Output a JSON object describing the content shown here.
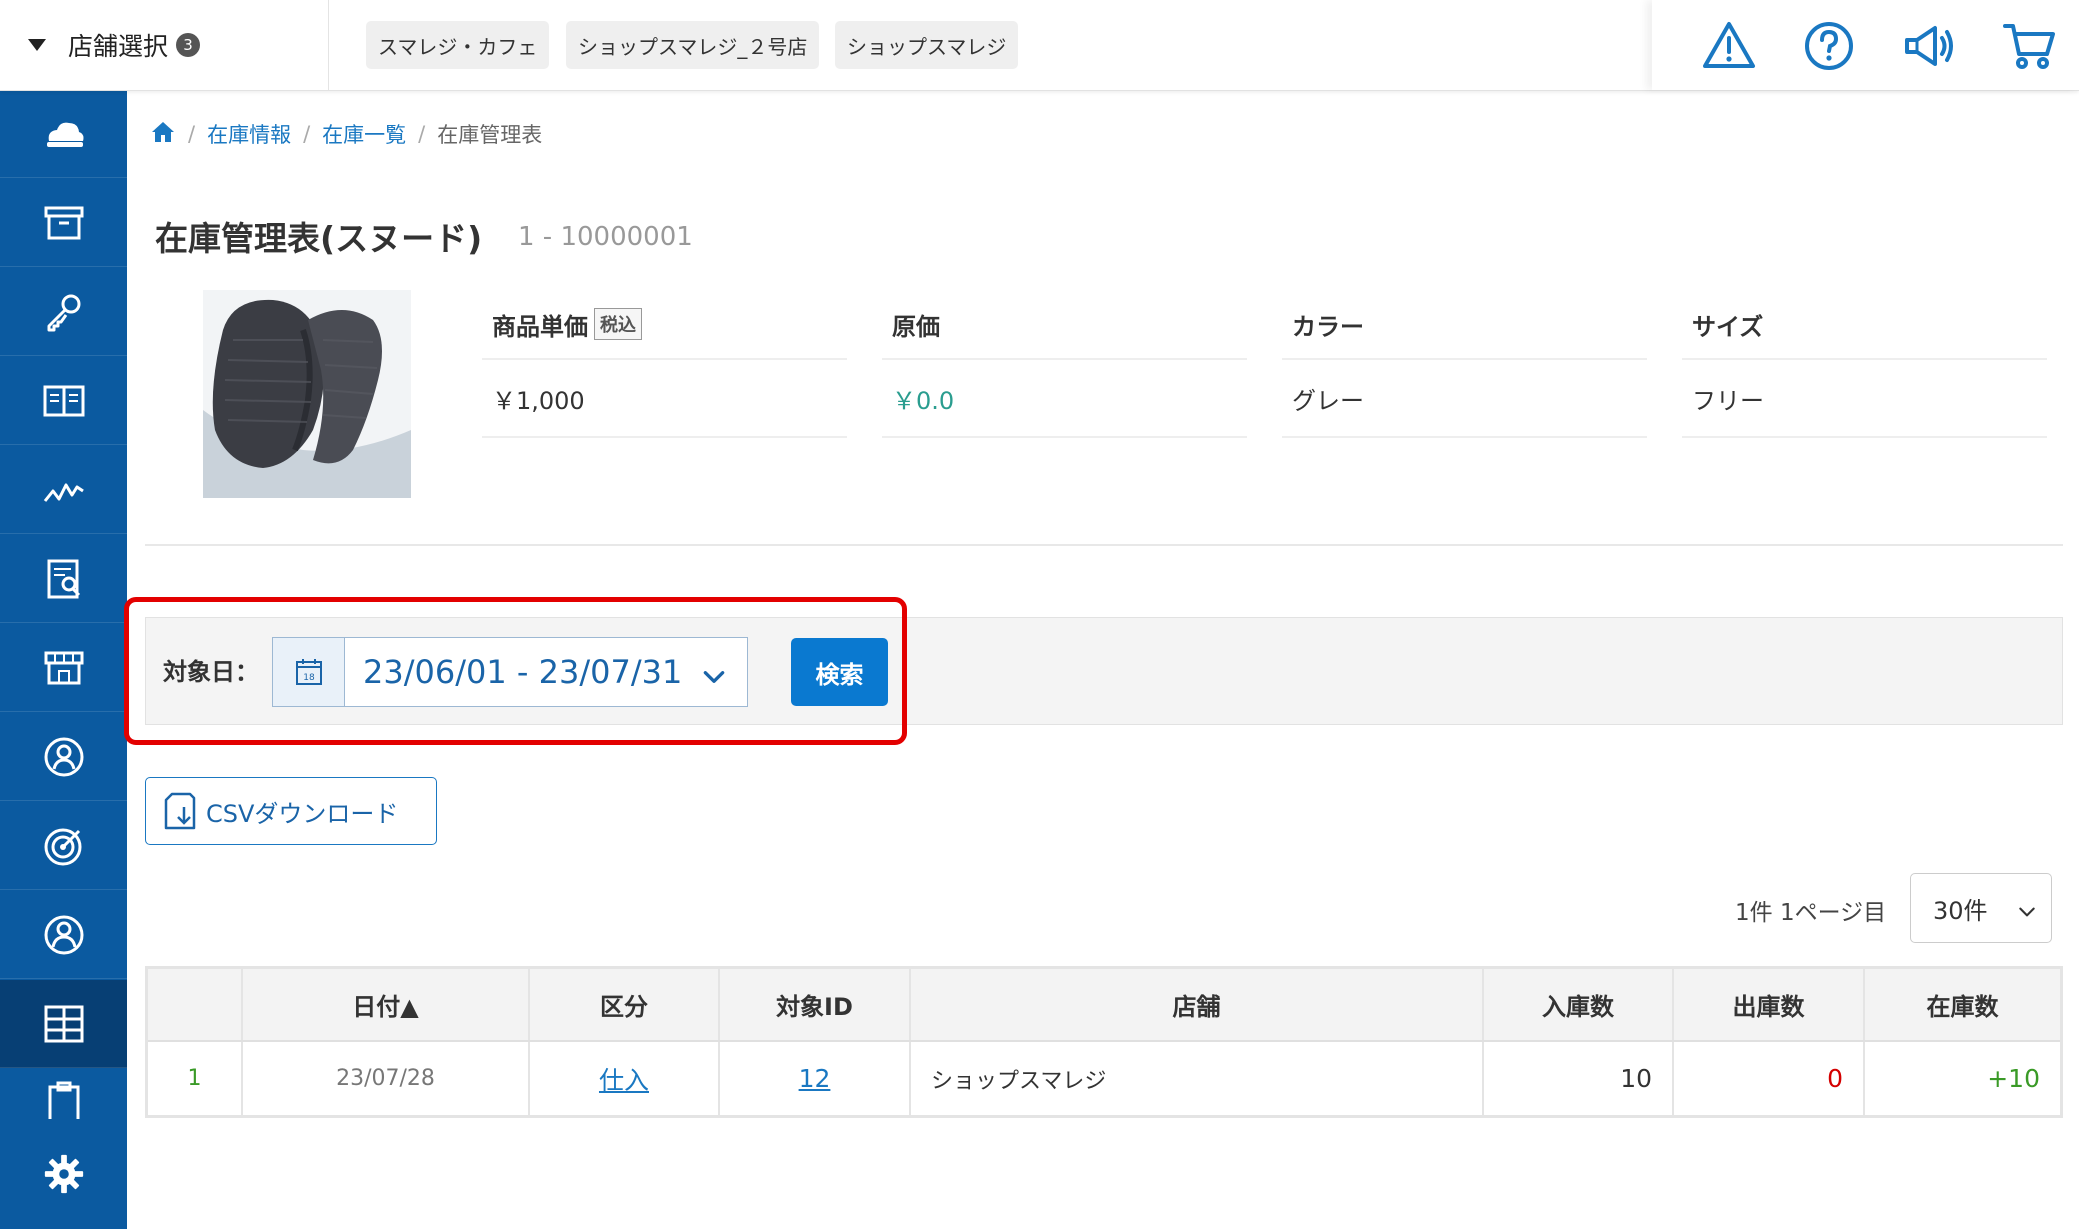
{
  "topbar": {
    "store_select_label": "店舗選択",
    "store_count": "3",
    "stores": [
      "スマレジ・カフェ",
      "ショップスマレジ_２号店",
      "ショップスマレジ"
    ],
    "icons": [
      "warning-icon",
      "help-icon",
      "megaphone-icon",
      "cart-icon"
    ]
  },
  "sidebar": {
    "items": [
      "cloud-icon",
      "archive-box-icon",
      "key-icon",
      "book-icon",
      "chart-line-icon",
      "report-search-icon",
      "store-icon",
      "user-badge-icon",
      "target-icon",
      "user-circle-icon",
      "grid-icon",
      "clipboard-icon"
    ],
    "active": "grid-icon",
    "bottom": "gear-icon"
  },
  "breadcrumb": {
    "home_icon": "home-icon",
    "items": [
      "在庫情報",
      "在庫一覧"
    ],
    "current": "在庫管理表"
  },
  "page": {
    "title": "在庫管理表(スヌード)",
    "code": "1 - 10000001"
  },
  "product": {
    "image_desc_icon": "product-photo",
    "columns": [
      {
        "label": "商品単価",
        "tag": "税込",
        "value": "￥1,000",
        "value_color": "#333333"
      },
      {
        "label": "原価",
        "tag": "",
        "value": "￥0.0",
        "value_color": "#2a9d8f"
      },
      {
        "label": "カラー",
        "tag": "",
        "value": "グレー",
        "value_color": "#333333"
      },
      {
        "label": "サイズ",
        "tag": "",
        "value": "フリー",
        "value_color": "#333333"
      }
    ]
  },
  "search": {
    "label": "対象日：",
    "calendar_day": "18",
    "date_range": "23/06/01 - 23/07/31",
    "button": "検索"
  },
  "csv": {
    "label": "CSVダウンロード"
  },
  "pagination": {
    "info": "1件 1ページ目",
    "per_page": "30件"
  },
  "table": {
    "headers": [
      "",
      "日付▲",
      "区分",
      "対象ID",
      "店舗",
      "入庫数",
      "出庫数",
      "在庫数"
    ],
    "rows": [
      {
        "no": "1",
        "date": "23/07/28",
        "type": "仕入",
        "target_id": "12",
        "store": "ショップスマレジ",
        "in": "10",
        "out": "0",
        "stock": "+10"
      }
    ]
  },
  "colors": {
    "primary": "#0a79d0",
    "sidebar": "#0b5aa0",
    "highlight": "#e30000",
    "positive": "#3a9a27",
    "negative": "#d40000"
  }
}
